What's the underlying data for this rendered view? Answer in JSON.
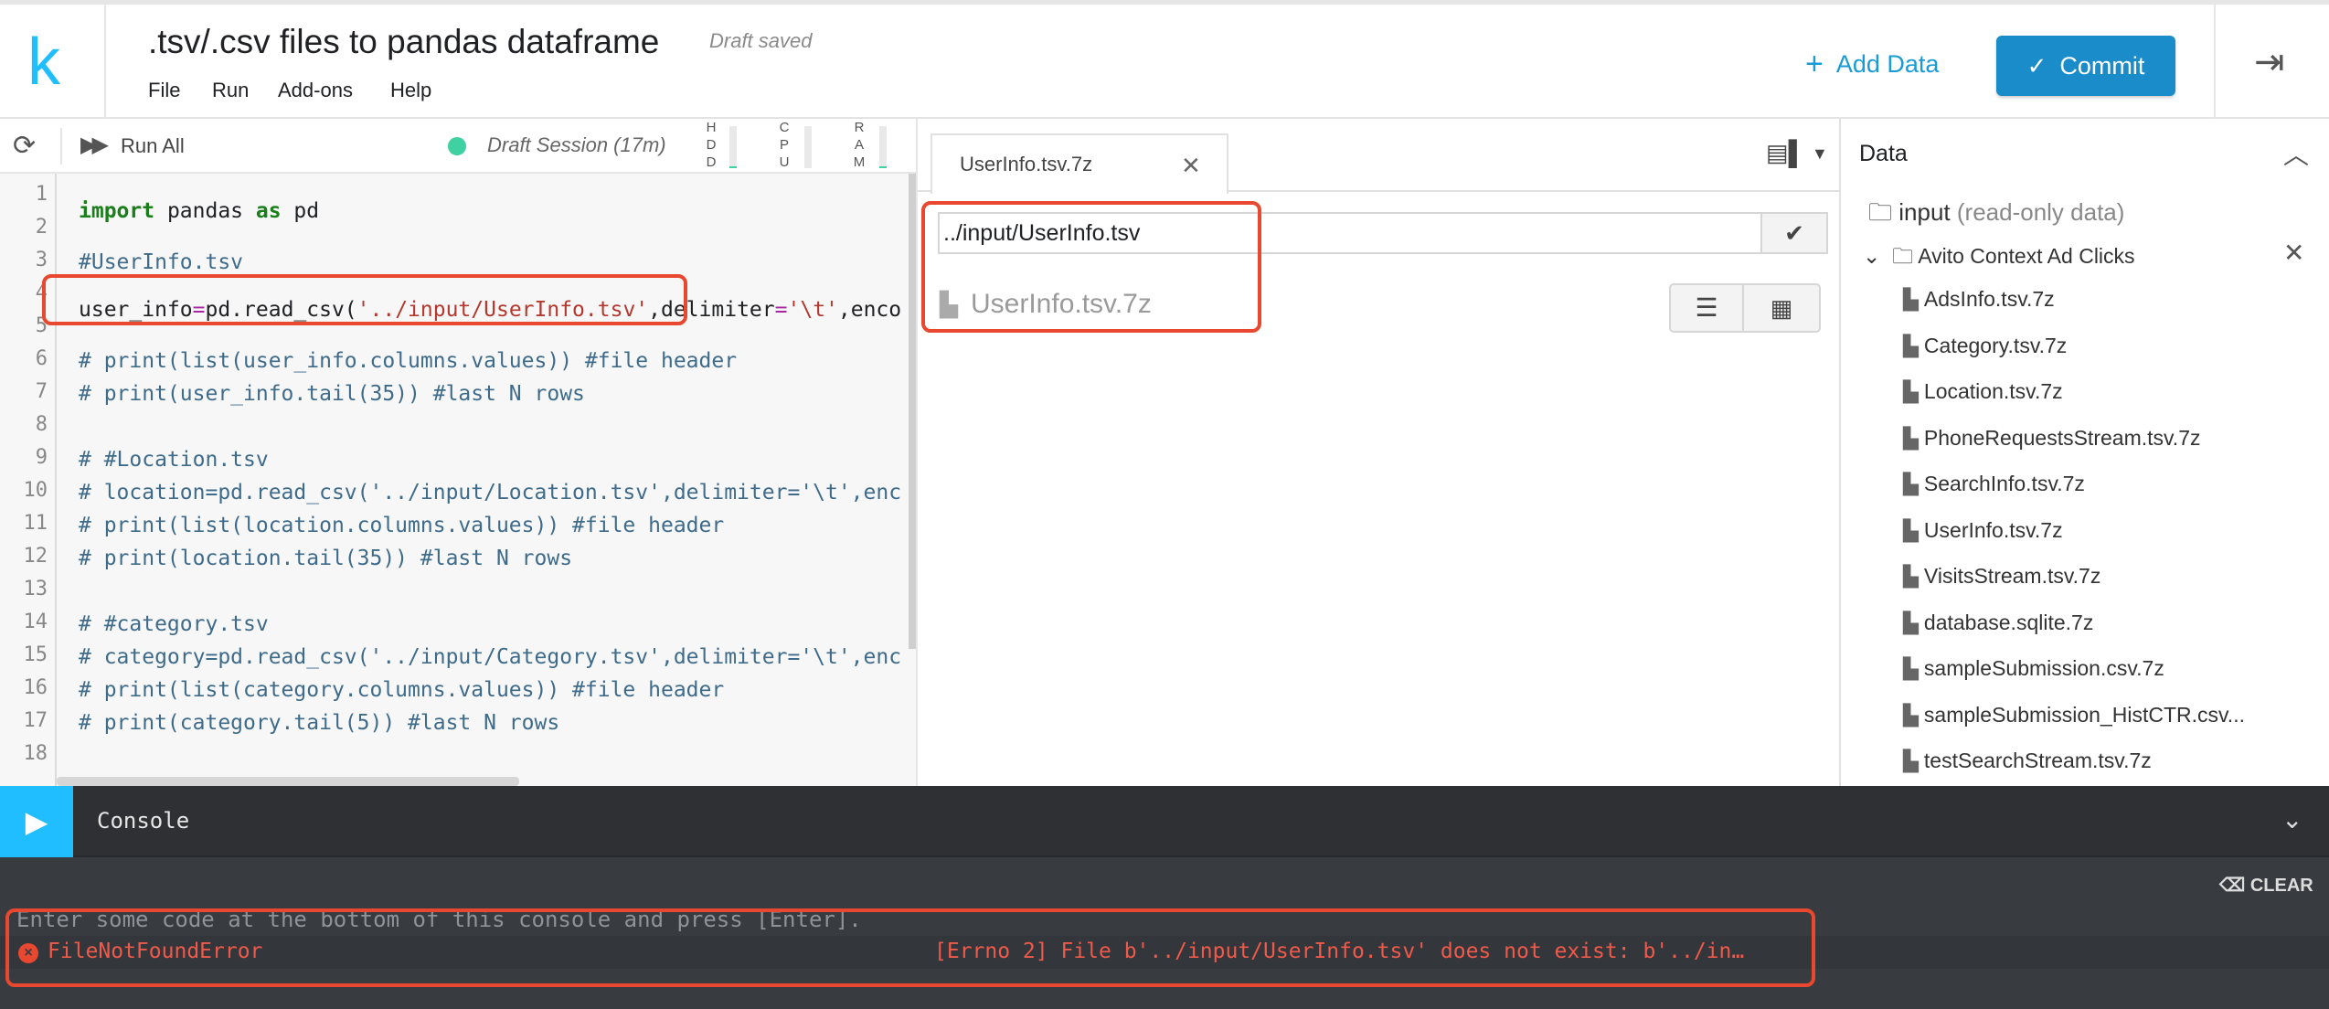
{
  "header": {
    "logo": "k",
    "title": ".tsv/.csv files to pandas dataframe",
    "draft_status": "Draft saved",
    "menu": [
      "File",
      "Run",
      "Add-ons",
      "Help"
    ],
    "add_data_label": "Add Data",
    "commit_label": "Commit"
  },
  "editor_toolbar": {
    "run_all_label": "Run All",
    "session_label": "Draft Session (17m)",
    "meters": [
      {
        "label": "HDD",
        "level": 0.05
      },
      {
        "label": "CPU",
        "level": 0.0
      },
      {
        "label": "RAM",
        "level": 0.05
      }
    ]
  },
  "code_lines": [
    {
      "n": "1"
    },
    {
      "n": "2"
    },
    {
      "n": "3",
      "text": "#UserInfo.tsv"
    },
    {
      "n": "4"
    },
    {
      "n": "5"
    },
    {
      "n": "6",
      "text": "# print(list(user_info.columns.values)) #file header"
    },
    {
      "n": "7",
      "text": "# print(user_info.tail(35)) #last N rows"
    },
    {
      "n": "8"
    },
    {
      "n": "9",
      "text": "# #Location.tsv"
    },
    {
      "n": "10",
      "text": "# location=pd.read_csv('../input/Location.tsv',delimiter='\\t',enc"
    },
    {
      "n": "11",
      "text": "# print(list(location.columns.values)) #file header"
    },
    {
      "n": "12",
      "text": "# print(location.tail(35)) #last N rows"
    },
    {
      "n": "13"
    },
    {
      "n": "14",
      "text": "# #category.tsv"
    },
    {
      "n": "15",
      "text": "# category=pd.read_csv('../input/Category.tsv',delimiter='\\t',enc"
    },
    {
      "n": "16",
      "text": "# print(list(category.columns.values)) #file header"
    },
    {
      "n": "17",
      "text": "# print(category.tail(5)) #last N rows"
    },
    {
      "n": "18"
    }
  ],
  "code_tokens": {
    "l1": {
      "kw1": "import",
      "mid": " pandas ",
      "kw2": "as",
      "end": " pd"
    },
    "l4": {
      "a": "user_info",
      "eq": "=",
      "b": "pd.read_csv(",
      "s1": "'../input/UserInfo.tsv'",
      "c": ",delimiter",
      "eq2": "=",
      "s2": "'\\t'",
      "d": ",enco"
    }
  },
  "viewer": {
    "tab_label": "UserInfo.tsv.7z",
    "path_value": "../input/UserInfo.tsv",
    "file_entry": "UserInfo.tsv.7z"
  },
  "sidebar": {
    "title": "Data",
    "root_folder": "input",
    "root_note": "(read-only data)",
    "dataset": "Avito Context Ad Clicks",
    "files": [
      "AdsInfo.tsv.7z",
      "Category.tsv.7z",
      "Location.tsv.7z",
      "PhoneRequestsStream.tsv.7z",
      "SearchInfo.tsv.7z",
      "UserInfo.tsv.7z",
      "VisitsStream.tsv.7z",
      "database.sqlite.7z",
      "sampleSubmission.csv.7z",
      "sampleSubmission_HistCTR.csv...",
      "testSearchStream.tsv.7z"
    ]
  },
  "console": {
    "title": "Console",
    "clear_label": "CLEAR",
    "hint": "Enter some code at the bottom of this console and press [Enter].",
    "error_name": "FileNotFoundError",
    "error_message": "[Errno 2] File b'../input/UserInfo.tsv' does not exist: b'../in…"
  },
  "colors": {
    "brand": "#20beff",
    "commit": "#1a8cc9",
    "highlight": "#e8482f",
    "session": "#3fd1a1"
  }
}
